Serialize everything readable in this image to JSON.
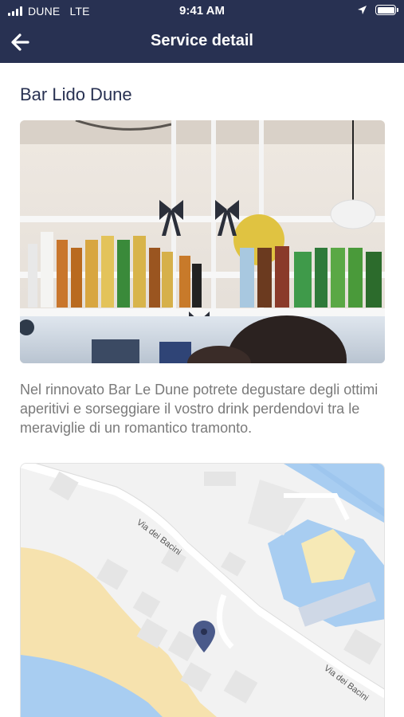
{
  "status_bar": {
    "carrier": "DUNE",
    "network": "LTE",
    "time": "9:41 AM"
  },
  "nav": {
    "title": "Service detail",
    "back_icon": "arrow-left-icon"
  },
  "service": {
    "name": "Bar Lido Dune",
    "description": "Nel rinnovato Bar Le Dune potrete degustare degli ottimi aperitivi e sorseggiare il vostro drink perdendovi tra le meraviglie di un romantico tramonto."
  },
  "map": {
    "street_label_1": "Via dei Bacini",
    "street_label_2": "Via dei Bacini",
    "marker_icon": "map-pin-icon"
  },
  "colors": {
    "header": "#283152",
    "title": "#283152",
    "body_text": "#7a7a7a",
    "marker": "#4a5a8a"
  }
}
